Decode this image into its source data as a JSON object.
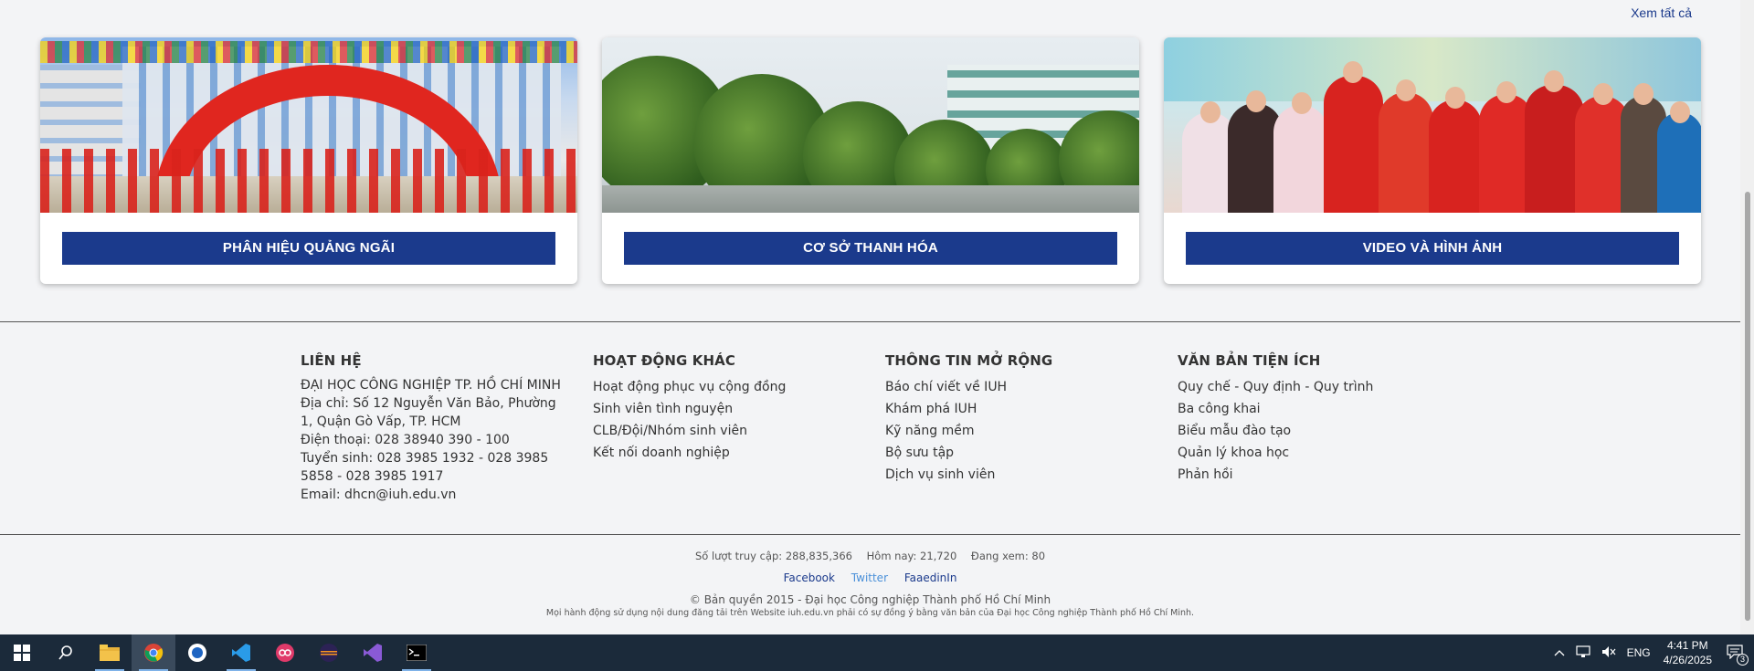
{
  "header": {
    "see_all": "Xem tất cả"
  },
  "cards": [
    {
      "label": "PHÂN HIỆU QUẢNG NGÃI"
    },
    {
      "label": "CƠ SỞ THANH HÓA"
    },
    {
      "label": "VIDEO VÀ HÌNH ẢNH"
    }
  ],
  "footer": {
    "contact": {
      "title": "LIÊN HỆ",
      "name": "ĐẠI HỌC CÔNG NGHIỆP TP. HỒ CHÍ MINH",
      "address": "Địa chỉ: Số 12 Nguyễn Văn Bảo, Phường 1, Quận Gò Vấp, TP. HCM",
      "phone": "Điện thoại: 028 38940 390 - 100",
      "admission": "Tuyển sinh: 028 3985 1932 - 028 3985 5858 - 028 3985 1917",
      "email": "Email: dhcn@iuh.edu.vn"
    },
    "activities": {
      "title": "HOẠT ĐỘNG KHÁC",
      "links": [
        "Hoạt động phục vụ cộng đồng",
        "Sinh viên tình nguyện",
        "CLB/Đội/Nhóm sinh viên",
        "Kết nối doanh nghiệp"
      ]
    },
    "extended": {
      "title": "THÔNG TIN MỞ RỘNG",
      "links": [
        "Báo chí viết về IUH",
        "Khám phá IUH",
        "Kỹ năng mềm",
        "Bộ sưu tập",
        "Dịch vụ sinh viên"
      ]
    },
    "documents": {
      "title": "VĂN BẢN TIỆN ÍCH",
      "links": [
        "Quy chế - Quy định - Quy trình",
        "Ba công khai",
        "Biểu mẫu đào tạo",
        "Quản lý khoa học",
        "Phản hồi"
      ]
    },
    "stats": {
      "visits": "Số lượt truy cập: 288,835,366",
      "today": "Hôm nay: 21,720",
      "viewing": "Đang xem: 80"
    },
    "social": {
      "facebook": "Facebook",
      "twitter": "Twitter",
      "linkedin": "FaaedinIn"
    },
    "copyright": "© Bản quyền 2015 - Đại học Công nghiệp Thành phố Hồ Chí Minh",
    "notice": "Mọi hành động sử dụng nội dung đăng tải trên Website iuh.edu.vn phải có sự đồng ý bằng văn bản của Đại học Công nghiệp Thành phố Hồ Chí Minh."
  },
  "colors": {
    "brand_blue": "#1b3a8c",
    "facebook": "#1b3a8c",
    "twitter": "#4a90d9",
    "linkedin": "#1b3a8c",
    "taskbar": "#1b2a3a"
  },
  "taskbar": {
    "icons": [
      "windows-start-icon",
      "search-icon",
      "file-explorer-icon",
      "chrome-icon",
      "app-icon",
      "vscode-icon",
      "app-red-icon",
      "eclipse-icon",
      "visual-studio-icon",
      "terminal-icon"
    ],
    "tray": {
      "language": "ENG",
      "time": "4:41 PM",
      "date": "4/26/2025",
      "notifications": "3"
    }
  }
}
